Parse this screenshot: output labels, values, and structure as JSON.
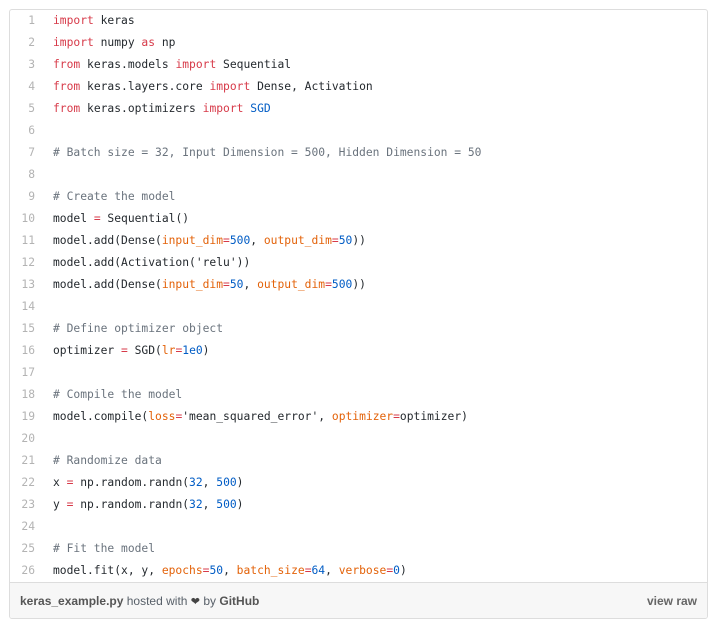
{
  "code_lines": [
    {
      "n": "1",
      "tokens": [
        [
          "kw",
          "import"
        ],
        [
          "",
          " keras"
        ]
      ]
    },
    {
      "n": "2",
      "tokens": [
        [
          "kw",
          "import"
        ],
        [
          "",
          " numpy "
        ],
        [
          "kw",
          "as"
        ],
        [
          "",
          " np"
        ]
      ]
    },
    {
      "n": "3",
      "tokens": [
        [
          "kw",
          "from"
        ],
        [
          "",
          " keras.models "
        ],
        [
          "kw",
          "import"
        ],
        [
          "",
          " Sequential"
        ]
      ]
    },
    {
      "n": "4",
      "tokens": [
        [
          "kw",
          "from"
        ],
        [
          "",
          " keras.layers.core "
        ],
        [
          "kw",
          "import"
        ],
        [
          "",
          " Dense, Activation"
        ]
      ]
    },
    {
      "n": "5",
      "tokens": [
        [
          "kw",
          "from"
        ],
        [
          "",
          " keras.optimizers "
        ],
        [
          "kw",
          "import"
        ],
        [
          "",
          " "
        ],
        [
          "nu",
          "SGD"
        ]
      ]
    },
    {
      "n": "6",
      "tokens": []
    },
    {
      "n": "7",
      "tokens": [
        [
          "cm",
          "# Batch size = 32, Input Dimension = 500, Hidden Dimension = 50"
        ]
      ]
    },
    {
      "n": "8",
      "tokens": []
    },
    {
      "n": "9",
      "tokens": [
        [
          "cm",
          "# Create the model"
        ]
      ]
    },
    {
      "n": "10",
      "tokens": [
        [
          "",
          "model "
        ],
        [
          "kw",
          "="
        ],
        [
          "",
          " Sequential()"
        ]
      ]
    },
    {
      "n": "11",
      "tokens": [
        [
          "",
          "model.add(Dense("
        ],
        [
          "at",
          "input_dim"
        ],
        [
          "kw",
          "="
        ],
        [
          "nu",
          "500"
        ],
        [
          "",
          ", "
        ],
        [
          "at",
          "output_dim"
        ],
        [
          "kw",
          "="
        ],
        [
          "nu",
          "50"
        ],
        [
          "",
          "))"
        ]
      ]
    },
    {
      "n": "12",
      "tokens": [
        [
          "",
          "model.add(Activation("
        ],
        [
          "st",
          "'relu'"
        ],
        [
          "",
          "))"
        ]
      ]
    },
    {
      "n": "13",
      "tokens": [
        [
          "",
          "model.add(Dense("
        ],
        [
          "at",
          "input_dim"
        ],
        [
          "kw",
          "="
        ],
        [
          "nu",
          "50"
        ],
        [
          "",
          ", "
        ],
        [
          "at",
          "output_dim"
        ],
        [
          "kw",
          "="
        ],
        [
          "nu",
          "500"
        ],
        [
          "",
          "))"
        ]
      ]
    },
    {
      "n": "14",
      "tokens": []
    },
    {
      "n": "15",
      "tokens": [
        [
          "cm",
          "# Define optimizer object"
        ]
      ]
    },
    {
      "n": "16",
      "tokens": [
        [
          "",
          "optimizer "
        ],
        [
          "kw",
          "="
        ],
        [
          "",
          " SGD("
        ],
        [
          "at",
          "lr"
        ],
        [
          "kw",
          "="
        ],
        [
          "nu",
          "1e0"
        ],
        [
          "",
          ")"
        ]
      ]
    },
    {
      "n": "17",
      "tokens": []
    },
    {
      "n": "18",
      "tokens": [
        [
          "cm",
          "# Compile the model"
        ]
      ]
    },
    {
      "n": "19",
      "tokens": [
        [
          "",
          "model.compile("
        ],
        [
          "at",
          "loss"
        ],
        [
          "kw",
          "="
        ],
        [
          "st",
          "'mean_squared_error'"
        ],
        [
          "",
          ", "
        ],
        [
          "at",
          "optimizer"
        ],
        [
          "kw",
          "="
        ],
        [
          "",
          "optimizer)"
        ]
      ]
    },
    {
      "n": "20",
      "tokens": []
    },
    {
      "n": "21",
      "tokens": [
        [
          "cm",
          "# Randomize data"
        ]
      ]
    },
    {
      "n": "22",
      "tokens": [
        [
          "",
          "x "
        ],
        [
          "kw",
          "="
        ],
        [
          "",
          " np.random.randn("
        ],
        [
          "nu",
          "32"
        ],
        [
          "",
          ", "
        ],
        [
          "nu",
          "500"
        ],
        [
          "",
          ")"
        ]
      ]
    },
    {
      "n": "23",
      "tokens": [
        [
          "",
          "y "
        ],
        [
          "kw",
          "="
        ],
        [
          "",
          " np.random.randn("
        ],
        [
          "nu",
          "32"
        ],
        [
          "",
          ", "
        ],
        [
          "nu",
          "500"
        ],
        [
          "",
          ")"
        ]
      ]
    },
    {
      "n": "24",
      "tokens": []
    },
    {
      "n": "25",
      "tokens": [
        [
          "cm",
          "# Fit the model"
        ]
      ]
    },
    {
      "n": "26",
      "tokens": [
        [
          "",
          "model.fit(x, y, "
        ],
        [
          "at",
          "epochs"
        ],
        [
          "kw",
          "="
        ],
        [
          "nu",
          "50"
        ],
        [
          "",
          ", "
        ],
        [
          "at",
          "batch_size"
        ],
        [
          "kw",
          "="
        ],
        [
          "nu",
          "64"
        ],
        [
          "",
          ", "
        ],
        [
          "at",
          "verbose"
        ],
        [
          "kw",
          "="
        ],
        [
          "nu",
          "0"
        ],
        [
          "",
          ")"
        ]
      ]
    }
  ],
  "footer": {
    "filename": "keras_example.py",
    "hosted_with": "hosted with",
    "heart_icon": "heart-icon",
    "by": "by",
    "github": "GitHub",
    "view_raw": "view raw"
  },
  "colors": {
    "keyword": "#d73a49",
    "comment": "#6a737d",
    "number": "#005cc5",
    "attribute": "#e36209"
  }
}
